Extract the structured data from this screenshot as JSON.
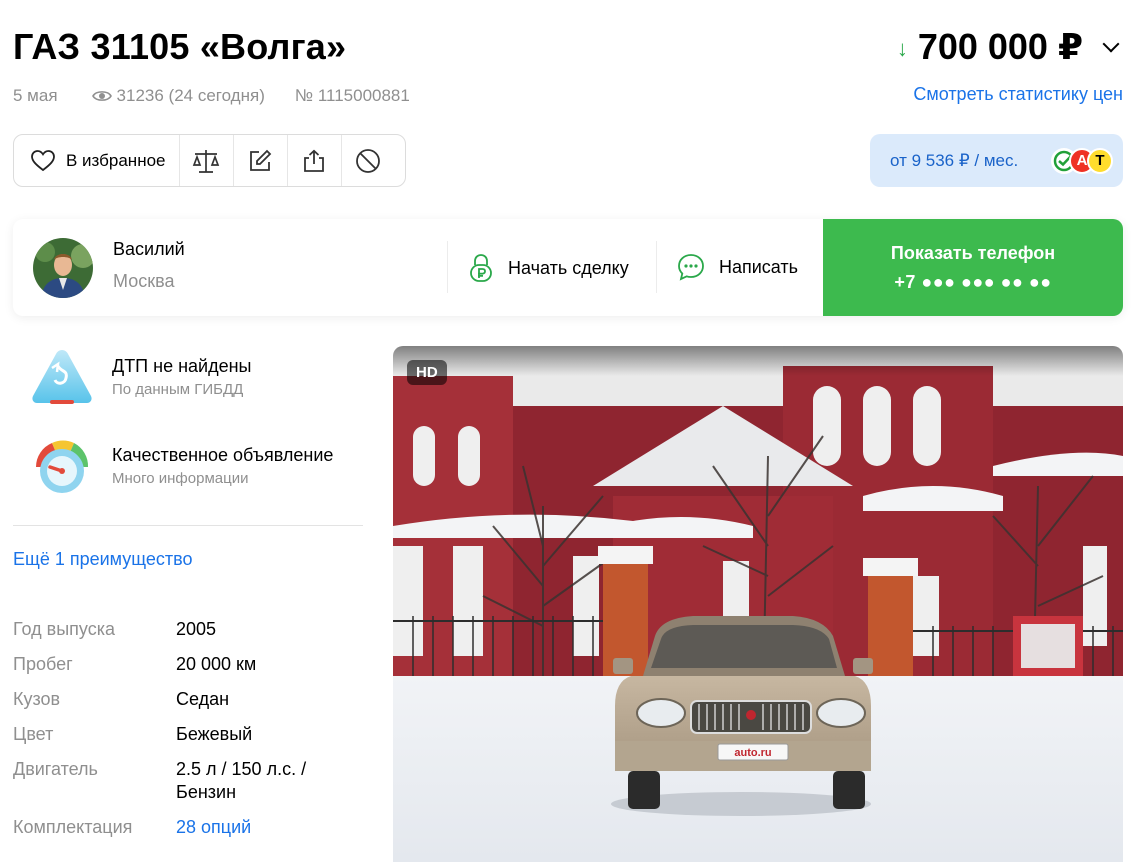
{
  "header": {
    "title": "ГАЗ 31105 «Волга»",
    "date": "5 мая",
    "views": "31236 (24 сегодня)",
    "listing_number": "№ 1115000881"
  },
  "price": {
    "value": "700 000 ₽",
    "trend_icon": "arrow-down-icon",
    "stats_link": "Смотреть статистику цен"
  },
  "actions": {
    "favorite_label": "В избранное",
    "icons": [
      "compare-icon",
      "edit-note-icon",
      "share-icon",
      "block-icon"
    ]
  },
  "credit": {
    "label": "от 9 536 ₽ / мес.",
    "banks": [
      "sber",
      "alfa",
      "tinkoff"
    ],
    "bank_letters": [
      "А",
      "Т"
    ]
  },
  "seller": {
    "name": "Василий",
    "city": "Москва",
    "deal_label": "Начать сделку",
    "message_label": "Написать",
    "phone_title": "Показать телефон",
    "phone_masked": "+7 ●●● ●●● ●● ●●"
  },
  "features": [
    {
      "title": "ДТП не найдены",
      "subtitle": "По данным ГИБДД"
    },
    {
      "title": "Качественное объявление",
      "subtitle": "Много информации"
    }
  ],
  "more_advantages": "Ещё 1 преимущество",
  "specs": [
    {
      "label": "Год выпуска",
      "value": "2005"
    },
    {
      "label": "Пробег",
      "value": "20 000 км"
    },
    {
      "label": "Кузов",
      "value": "Седан"
    },
    {
      "label": "Цвет",
      "value": "Бежевый"
    },
    {
      "label": "Двигатель",
      "value": "2.5 л / 150 л.с. / Бензин"
    },
    {
      "label": "Комплектация",
      "value": "28 опций"
    }
  ],
  "photo": {
    "badge": "HD",
    "plate_text": "auto.ru"
  },
  "colors": {
    "accent_blue": "#1a73e8",
    "green": "#3dba4e",
    "credit_bg": "#dbeafb"
  }
}
